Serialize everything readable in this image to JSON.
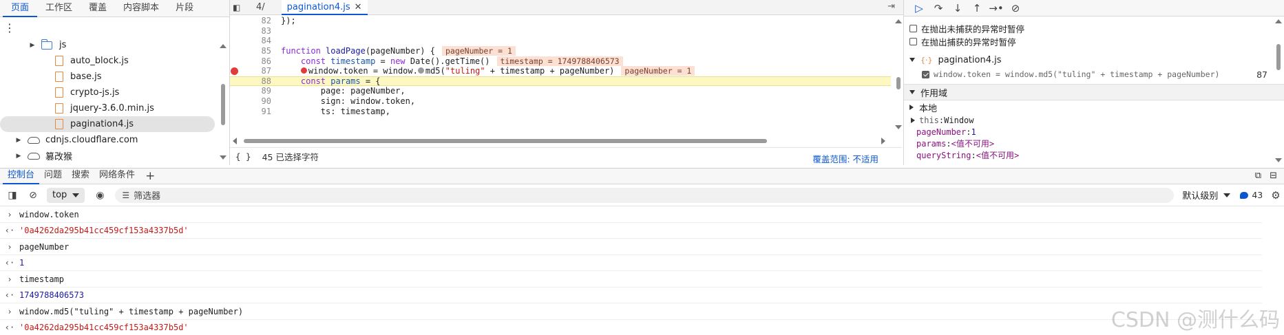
{
  "left_panel": {
    "tabs": [
      "页面",
      "工作区",
      "覆盖",
      "内容脚本",
      "片段"
    ],
    "more_icon": "⋮",
    "tree": [
      {
        "label": "js",
        "icon": "folder-icon",
        "indent": 1,
        "arrow": "▶"
      },
      {
        "label": "auto_block.js",
        "icon": "file-icon",
        "indent": 2
      },
      {
        "label": "base.js",
        "icon": "file-icon",
        "indent": 2
      },
      {
        "label": "crypto-js.js",
        "icon": "file-icon",
        "indent": 2
      },
      {
        "label": "jquery-3.6.0.min.js",
        "icon": "file-icon",
        "indent": 2
      },
      {
        "label": "pagination4.js",
        "icon": "file-icon",
        "indent": 2,
        "selected": true
      },
      {
        "label": "cdnjs.cloudflare.com",
        "icon": "cloud-icon",
        "indent": 0,
        "arrow": "▶"
      },
      {
        "label": "篡改猴",
        "icon": "cloud-icon",
        "indent": 0,
        "arrow": "▶"
      }
    ]
  },
  "editor": {
    "tabs": [
      {
        "label": "4/"
      },
      {
        "label": "pagination4.js",
        "active": true
      }
    ],
    "lines": [
      {
        "n": "82",
        "html": "<span class=\"code-text\">});</span>"
      },
      {
        "n": "83",
        "html": ""
      },
      {
        "n": "84",
        "html": ""
      },
      {
        "n": "85",
        "html": "<span class=\"kw\">function</span> <span class=\"fn\">loadPage</span>(pageNumber) {<span class=\"inline-val\">pageNumber = 1</span>"
      },
      {
        "n": "86",
        "html": "    <span class=\"kw\">const</span> <span class=\"var\">timestamp</span> = <span class=\"kw\">new</span> Date().getTime()<span class=\"inline-val\">timestamp = 1749788406573</span>"
      },
      {
        "n": "87",
        "html": "    <span class=\"inline-bp\"></span>window.token = window.<span class=\"inline-bp grey\"></span>md5(<span class=\"str\">\"tuling\"</span> + timestamp + pageNumber)<span class=\"inline-val\">pageNumber = 1</span>",
        "breakpoint": true
      },
      {
        "n": "88",
        "html": "    <span class=\"kw\">const</span> <span class=\"var\">params</span> = {",
        "paused": true
      },
      {
        "n": "89",
        "html": "        page: pageNumber,"
      },
      {
        "n": "90",
        "html": "        sign: window.token,"
      },
      {
        "n": "91",
        "html": "        ts: timestamp,"
      }
    ],
    "status_braces": "{ }",
    "status_selection": "45 已选择字符",
    "coverage": "覆盖范围: 不适用"
  },
  "debugger": {
    "toolbar_icons": [
      "resume-icon",
      "step-over-icon",
      "step-into-icon",
      "step-out-icon",
      "step-icon",
      "deactivate-breakpoints-icon"
    ],
    "toolbar_glyphs": [
      "▷",
      "↷",
      "↓",
      "↑",
      "→•",
      "⊘"
    ],
    "pause_uncaught": "在抛出未捕获的异常时暂停",
    "pause_caught": "在抛出捕获的异常时暂停",
    "bp_file": "pagination4.js",
    "bp_code": "window.token = window.md5(\"tuling\" + timestamp + pageNumber)",
    "bp_line": "87",
    "scope_title": "作用域",
    "local_title": "本地",
    "scope_items": [
      {
        "key": "this",
        "val": "Window",
        "type": "obj"
      },
      {
        "key": "pageNumber",
        "val": "1",
        "type": "num"
      },
      {
        "key": "params",
        "val": "<值不可用>",
        "type": "na"
      },
      {
        "key": "queryString",
        "val": "<值不可用>",
        "type": "na"
      }
    ]
  },
  "drawer": {
    "tabs": [
      "控制台",
      "问题",
      "搜索",
      "网络条件"
    ],
    "plus": "+",
    "context": "top",
    "filter_placeholder": "筛选器",
    "level": "默认级别",
    "count": "43"
  },
  "console": [
    {
      "kind": "in",
      "text": "window.token"
    },
    {
      "kind": "out-str",
      "text": "'0a4262da295b41cc459cf153a4337b5d'"
    },
    {
      "kind": "in",
      "text": "pageNumber"
    },
    {
      "kind": "out-num",
      "text": "1"
    },
    {
      "kind": "in",
      "text": "timestamp"
    },
    {
      "kind": "out-num",
      "text": "1749788406573"
    },
    {
      "kind": "in",
      "text": "window.md5(\"tuling\" + timestamp + pageNumber)"
    },
    {
      "kind": "out-str",
      "text": "'0a4262da295b41cc459cf153a4337b5d'"
    }
  ],
  "watermark": "CSDN @测什么码"
}
